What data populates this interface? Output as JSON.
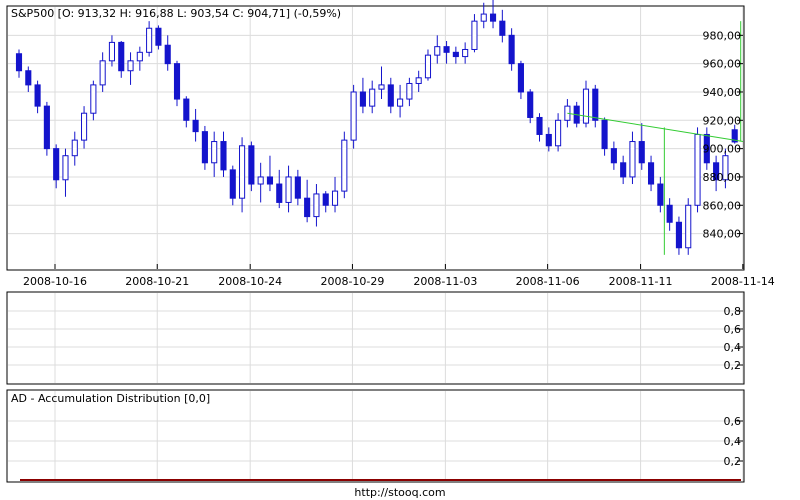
{
  "colors": {
    "background": "#ffffff",
    "panel_border": "#000000",
    "grid": "#dcdcdc",
    "candle_bear": "#1414cc",
    "candle_bull": "#1414cc",
    "trendline": "#33cc33",
    "ad_line": "#8b0000"
  },
  "chart_data": [
    {
      "type": "candlestick",
      "title": "S&P500 [O: 913,32  H: 916,88  L: 903,54  C: 904,71] (-0,59%)",
      "x_tick_labels": [
        "2008-10-16",
        "2008-10-21",
        "2008-10-24",
        "2008-10-29",
        "2008-11-03",
        "2008-11-06",
        "2008-11-11",
        "2008-11-14"
      ],
      "y_ticks": [
        840,
        860,
        880,
        900,
        920,
        940,
        960,
        980
      ],
      "y_tick_labels": [
        "840,00",
        "860,00",
        "880,00",
        "900,00",
        "920,00",
        "940,00",
        "960,00",
        "980,00"
      ],
      "ylim": [
        815,
        1000
      ],
      "grid": true,
      "candles": [
        {
          "o": 967,
          "h": 970,
          "l": 950,
          "c": 955
        },
        {
          "o": 955,
          "h": 958,
          "l": 940,
          "c": 945
        },
        {
          "o": 945,
          "h": 948,
          "l": 925,
          "c": 930
        },
        {
          "o": 930,
          "h": 933,
          "l": 895,
          "c": 900
        },
        {
          "o": 900,
          "h": 903,
          "l": 872,
          "c": 878
        },
        {
          "o": 878,
          "h": 900,
          "l": 866,
          "c": 895
        },
        {
          "o": 895,
          "h": 912,
          "l": 888,
          "c": 906
        },
        {
          "o": 906,
          "h": 930,
          "l": 900,
          "c": 925
        },
        {
          "o": 925,
          "h": 948,
          "l": 920,
          "c": 945
        },
        {
          "o": 945,
          "h": 968,
          "l": 940,
          "c": 962
        },
        {
          "o": 962,
          "h": 980,
          "l": 958,
          "c": 975
        },
        {
          "o": 975,
          "h": 976,
          "l": 950,
          "c": 955
        },
        {
          "o": 955,
          "h": 968,
          "l": 945,
          "c": 962
        },
        {
          "o": 962,
          "h": 972,
          "l": 955,
          "c": 968
        },
        {
          "o": 968,
          "h": 990,
          "l": 965,
          "c": 985
        },
        {
          "o": 985,
          "h": 987,
          "l": 970,
          "c": 973
        },
        {
          "o": 973,
          "h": 980,
          "l": 955,
          "c": 960
        },
        {
          "o": 960,
          "h": 962,
          "l": 930,
          "c": 935
        },
        {
          "o": 935,
          "h": 937,
          "l": 915,
          "c": 920
        },
        {
          "o": 920,
          "h": 928,
          "l": 905,
          "c": 912
        },
        {
          "o": 912,
          "h": 916,
          "l": 885,
          "c": 890
        },
        {
          "o": 890,
          "h": 912,
          "l": 880,
          "c": 905
        },
        {
          "o": 905,
          "h": 912,
          "l": 880,
          "c": 885
        },
        {
          "o": 885,
          "h": 888,
          "l": 860,
          "c": 865
        },
        {
          "o": 865,
          "h": 908,
          "l": 855,
          "c": 902
        },
        {
          "o": 902,
          "h": 905,
          "l": 870,
          "c": 875
        },
        {
          "o": 875,
          "h": 890,
          "l": 862,
          "c": 880
        },
        {
          "o": 880,
          "h": 895,
          "l": 870,
          "c": 875
        },
        {
          "o": 875,
          "h": 885,
          "l": 858,
          "c": 862
        },
        {
          "o": 862,
          "h": 888,
          "l": 855,
          "c": 880
        },
        {
          "o": 880,
          "h": 885,
          "l": 860,
          "c": 865
        },
        {
          "o": 865,
          "h": 878,
          "l": 848,
          "c": 852
        },
        {
          "o": 852,
          "h": 875,
          "l": 845,
          "c": 868
        },
        {
          "o": 868,
          "h": 870,
          "l": 855,
          "c": 860
        },
        {
          "o": 860,
          "h": 880,
          "l": 855,
          "c": 870
        },
        {
          "o": 870,
          "h": 912,
          "l": 865,
          "c": 906
        },
        {
          "o": 906,
          "h": 945,
          "l": 900,
          "c": 940
        },
        {
          "o": 940,
          "h": 950,
          "l": 925,
          "c": 930
        },
        {
          "o": 930,
          "h": 948,
          "l": 925,
          "c": 942
        },
        {
          "o": 942,
          "h": 958,
          "l": 935,
          "c": 945
        },
        {
          "o": 945,
          "h": 950,
          "l": 925,
          "c": 930
        },
        {
          "o": 930,
          "h": 945,
          "l": 922,
          "c": 935
        },
        {
          "o": 935,
          "h": 950,
          "l": 930,
          "c": 946
        },
        {
          "o": 946,
          "h": 955,
          "l": 940,
          "c": 950
        },
        {
          "o": 950,
          "h": 970,
          "l": 948,
          "c": 966
        },
        {
          "o": 966,
          "h": 980,
          "l": 960,
          "c": 972
        },
        {
          "o": 972,
          "h": 976,
          "l": 960,
          "c": 968
        },
        {
          "o": 968,
          "h": 972,
          "l": 960,
          "c": 965
        },
        {
          "o": 965,
          "h": 975,
          "l": 960,
          "c": 970
        },
        {
          "o": 970,
          "h": 995,
          "l": 968,
          "c": 990
        },
        {
          "o": 990,
          "h": 1003,
          "l": 985,
          "c": 995
        },
        {
          "o": 995,
          "h": 1005,
          "l": 985,
          "c": 990
        },
        {
          "o": 990,
          "h": 998,
          "l": 975,
          "c": 980
        },
        {
          "o": 980,
          "h": 985,
          "l": 955,
          "c": 960
        },
        {
          "o": 960,
          "h": 962,
          "l": 935,
          "c": 940
        },
        {
          "o": 940,
          "h": 942,
          "l": 918,
          "c": 922
        },
        {
          "o": 922,
          "h": 925,
          "l": 905,
          "c": 910
        },
        {
          "o": 910,
          "h": 915,
          "l": 898,
          "c": 902
        },
        {
          "o": 902,
          "h": 925,
          "l": 898,
          "c": 920
        },
        {
          "o": 920,
          "h": 935,
          "l": 915,
          "c": 930
        },
        {
          "o": 930,
          "h": 933,
          "l": 915,
          "c": 918
        },
        {
          "o": 918,
          "h": 948,
          "l": 915,
          "c": 942
        },
        {
          "o": 942,
          "h": 945,
          "l": 915,
          "c": 920
        },
        {
          "o": 920,
          "h": 922,
          "l": 895,
          "c": 900
        },
        {
          "o": 900,
          "h": 905,
          "l": 885,
          "c": 890
        },
        {
          "o": 890,
          "h": 895,
          "l": 875,
          "c": 880
        },
        {
          "o": 880,
          "h": 912,
          "l": 875,
          "c": 905
        },
        {
          "o": 905,
          "h": 918,
          "l": 885,
          "c": 890
        },
        {
          "o": 890,
          "h": 895,
          "l": 870,
          "c": 875
        },
        {
          "o": 875,
          "h": 880,
          "l": 855,
          "c": 860
        },
        {
          "o": 860,
          "h": 865,
          "l": 842,
          "c": 848
        },
        {
          "o": 848,
          "h": 852,
          "l": 825,
          "c": 830
        },
        {
          "o": 830,
          "h": 865,
          "l": 825,
          "c": 860
        },
        {
          "o": 860,
          "h": 915,
          "l": 855,
          "c": 910
        },
        {
          "o": 910,
          "h": 915,
          "l": 885,
          "c": 890
        },
        {
          "o": 890,
          "h": 895,
          "l": 870,
          "c": 878
        },
        {
          "o": 878,
          "h": 900,
          "l": 872,
          "c": 895
        },
        {
          "o": 913.32,
          "h": 916.88,
          "l": 903.54,
          "c": 904.71
        }
      ],
      "trendlines": [
        {
          "x1": "2008-11-06",
          "y1": 925,
          "x2": "2008-11-14",
          "y2": 905
        },
        {
          "x1": "2008-11-14",
          "y1": 825,
          "x2": "2008-11-14",
          "y2": 915
        },
        {
          "x1": "2008-11-14",
          "y1": 905,
          "x2": "2008-11-14",
          "y2": 990
        }
      ]
    },
    {
      "type": "line",
      "title": "",
      "y_ticks": [
        0.2,
        0.4,
        0.6,
        0.8
      ],
      "y_tick_labels": [
        "0,2",
        "0,4",
        "0,6",
        "0,8"
      ],
      "ylim": [
        0,
        1
      ],
      "grid": true,
      "series": []
    },
    {
      "type": "line",
      "title": "AD - Accumulation Distribution [0,0]",
      "y_ticks": [
        0.2,
        0.4,
        0.6
      ],
      "y_tick_labels": [
        "0,2",
        "0,4",
        "0,6"
      ],
      "ylim": [
        0,
        0.9
      ],
      "grid": true,
      "series": [
        {
          "values": [
            0,
            0
          ]
        }
      ]
    }
  ],
  "footer": {
    "url": "http://stooq.com"
  }
}
